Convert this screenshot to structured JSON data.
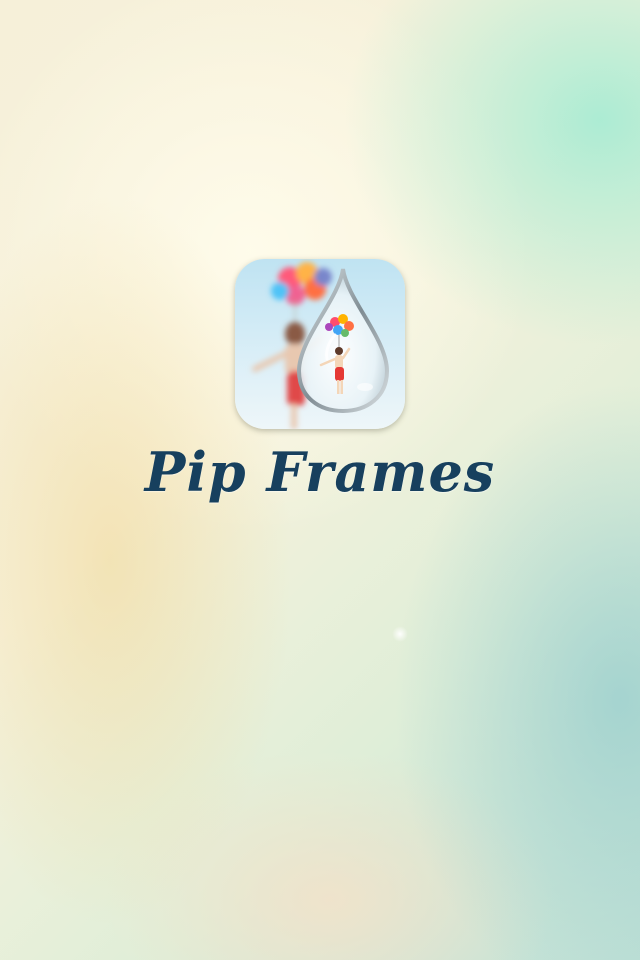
{
  "app": {
    "title": "Pip Frames",
    "icon": "pip-frames-app-icon"
  },
  "colors": {
    "title": "#17405e",
    "background_top": "#f6f0d9",
    "background_right": "#bfe0d6",
    "accent_mint": "#a0ebd2"
  }
}
